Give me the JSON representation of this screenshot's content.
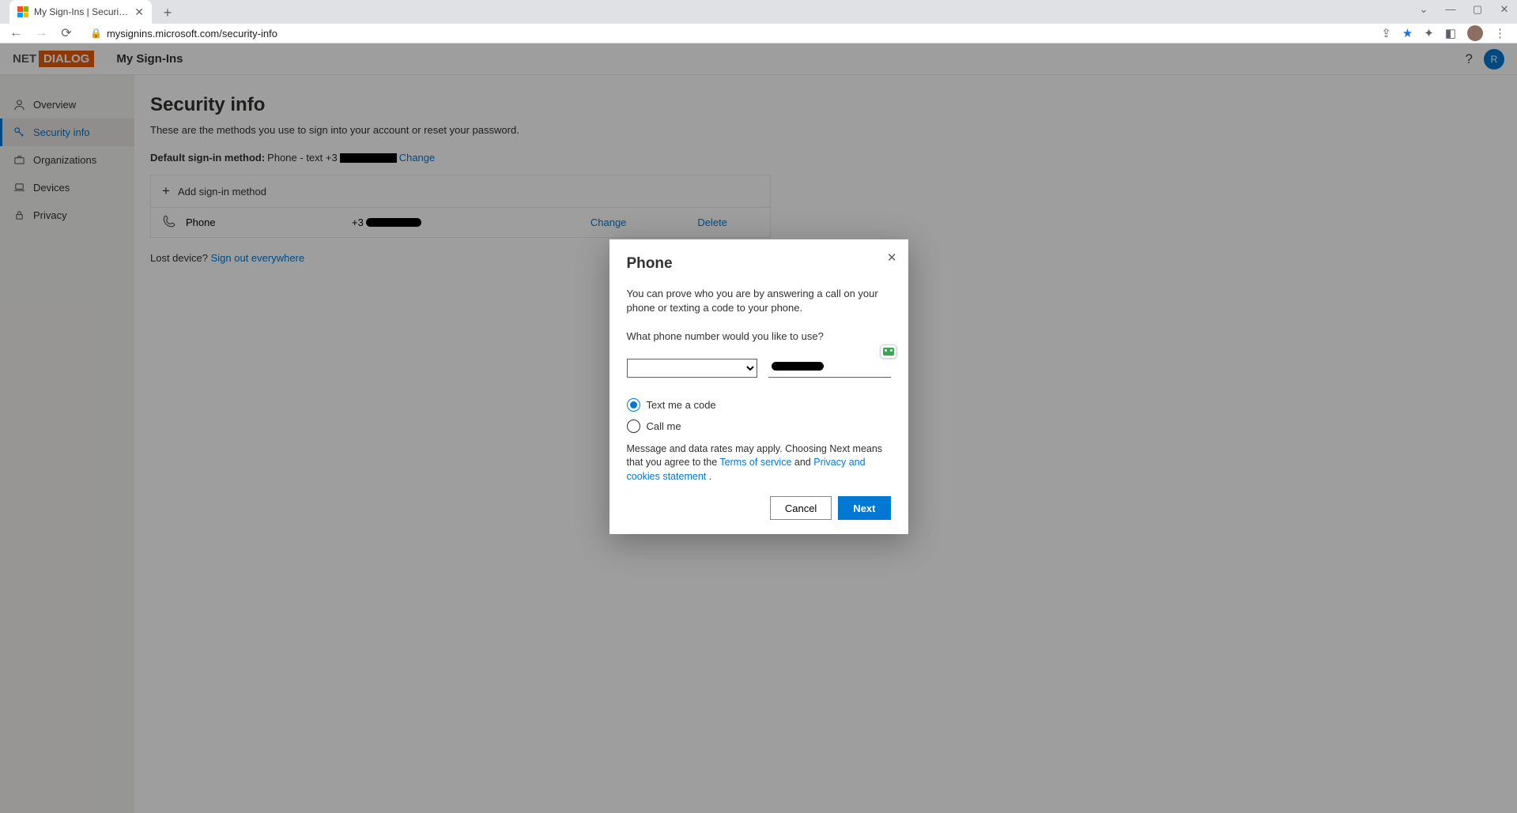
{
  "browser": {
    "tab_title": "My Sign-Ins | Security Info | Micr",
    "url": "mysignins.microsoft.com/security-info"
  },
  "header": {
    "brand_left": "NET",
    "brand_right": "DIALOG",
    "title": "My Sign-Ins",
    "avatar_initial": "R"
  },
  "sidebar": {
    "items": [
      {
        "label": "Overview"
      },
      {
        "label": "Security info"
      },
      {
        "label": "Organizations"
      },
      {
        "label": "Devices"
      },
      {
        "label": "Privacy"
      }
    ]
  },
  "main": {
    "heading": "Security info",
    "subtitle": "These are the methods you use to sign into your account or reset your password.",
    "default_label": "Default sign-in method:",
    "default_value_prefix": "Phone - text +3",
    "change": "Change",
    "add_label": "Add sign-in method",
    "method_label": "Phone",
    "method_value_prefix": "+3",
    "action_change": "Change",
    "action_delete": "Delete",
    "lost_prefix": "Lost device? ",
    "lost_link": "Sign out everywhere"
  },
  "dialog": {
    "title": "Phone",
    "intro": "You can prove who you are by answering a call on your phone or texting a code to your phone.",
    "question": "What phone number would you like to use?",
    "radio_text": "Text me a code",
    "radio_call": "Call me",
    "disclaimer_a": "Message and data rates may apply. Choosing Next means that you agree to the ",
    "tos": "Terms of service",
    "and": " and ",
    "priv": "Privacy and cookies statement",
    "dot": ".",
    "cancel": "Cancel",
    "next": "Next"
  }
}
